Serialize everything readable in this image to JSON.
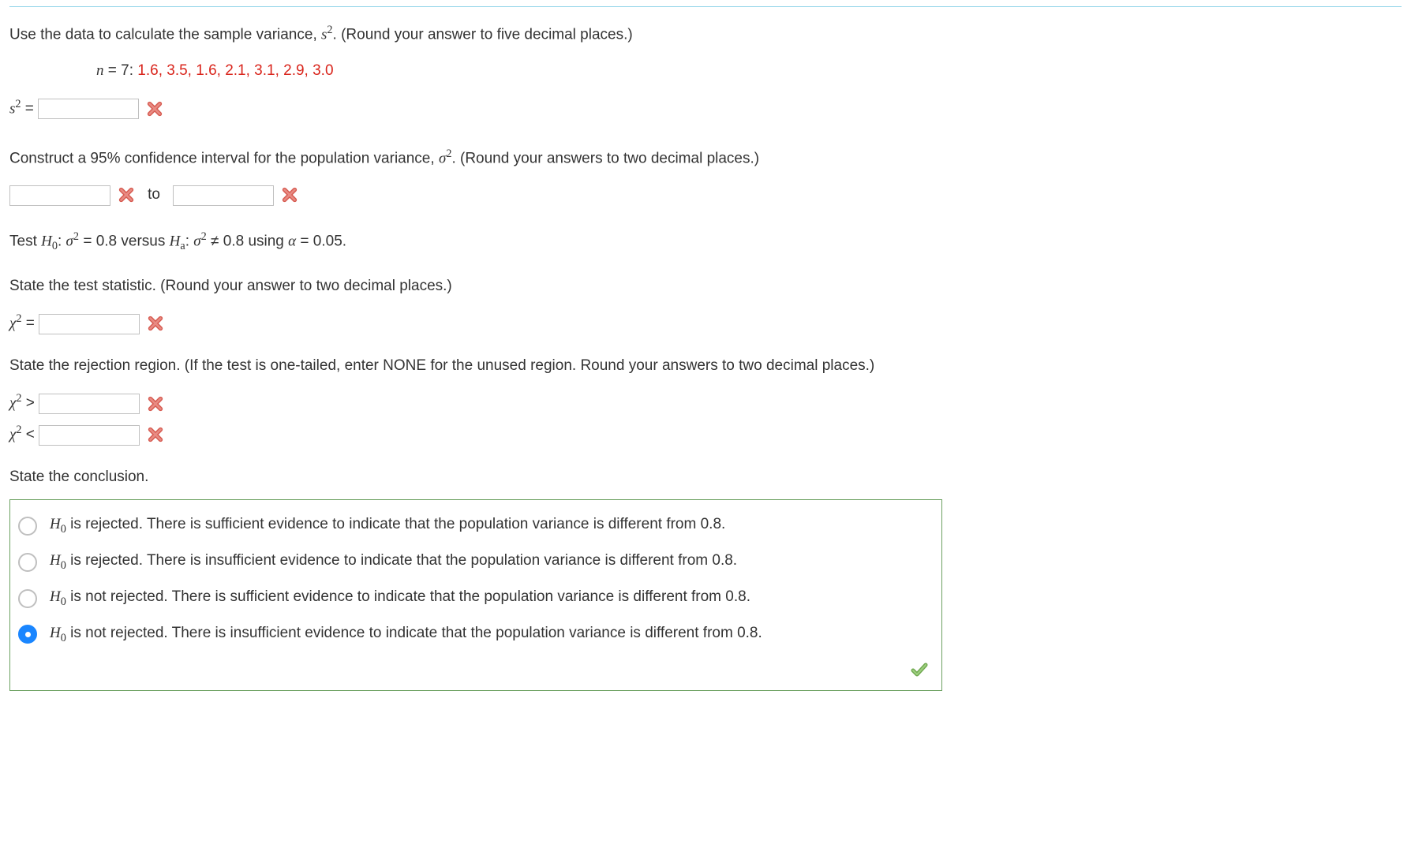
{
  "q1": {
    "prompt_a": "Use the data to calculate the sample variance, ",
    "prompt_b": ". (Round your answer to five decimal places.)",
    "n_label": "n",
    "n_eq": " = 7: ",
    "data_values": "1.6, 3.5, 1.6, 2.1, 3.1, 2.9, 3.0",
    "s_label": "s",
    "eq": " = "
  },
  "q2": {
    "prompt_a": "Construct a 95% confidence interval for the population variance, ",
    "prompt_b": ". (Round your answers to two decimal places.)",
    "to": "to"
  },
  "q3": {
    "test_a": "Test ",
    "h0": "H",
    "h0sub": "0",
    "colon1": ": ",
    "sigma": "σ",
    "eq08": " = 0.8 versus ",
    "ha": "H",
    "hasub": "a",
    "colon2": ": ",
    "ne": " ≠ 0.8 using ",
    "alpha": "α",
    "alpha_eq": " = 0.05."
  },
  "q4": {
    "prompt": "State the test statistic. (Round your answer to two decimal places.)",
    "chi": "χ",
    "eq": " = "
  },
  "q5": {
    "prompt": "State the rejection region. (If the test is one-tailed, enter NONE for the unused region. Round your answers to two decimal places.)",
    "chi": "χ",
    "gt": " > ",
    "lt": " < "
  },
  "q6": {
    "prompt": "State the conclusion.",
    "opts": [
      {
        "pre": "H",
        "sub": "0",
        "text": " is rejected. There is sufficient evidence to indicate that the population variance is different from 0.8."
      },
      {
        "pre": "H",
        "sub": "0",
        "text": " is rejected. There is insufficient evidence to indicate that the population variance is different from 0.8."
      },
      {
        "pre": "H",
        "sub": "0",
        "text": " is not rejected. There is sufficient evidence to indicate that the population variance is different from 0.8."
      },
      {
        "pre": "H",
        "sub": "0",
        "text": " is not rejected. There is insufficient evidence to indicate that the population variance is different from 0.8."
      }
    ],
    "selected_index": 3
  }
}
